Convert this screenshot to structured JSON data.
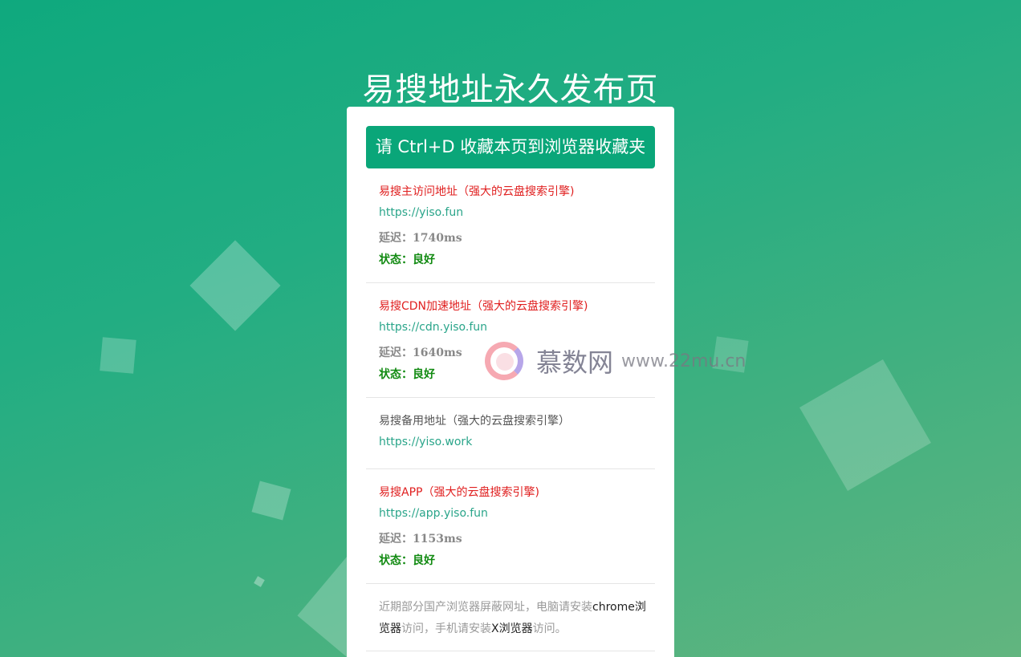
{
  "page": {
    "title": "易搜地址永久发布页"
  },
  "banner": {
    "text": "请 Ctrl+D 收藏本页到浏览器收藏夹"
  },
  "entries": [
    {
      "name": "易搜主访问地址（强大的云盘搜索引擎)",
      "url": "https://yiso.fun",
      "latency": "延迟：1740ms",
      "status": "状态：良好"
    },
    {
      "name": "易搜CDN加速地址（强大的云盘搜索引擎)",
      "url": "https://cdn.yiso.fun",
      "latency": "延迟：1640ms",
      "status": "状态：良好"
    },
    {
      "name": "易搜备用地址（强大的云盘搜索引擎）",
      "url": "https://yiso.work"
    },
    {
      "name": "易搜APP（强大的云盘搜索引擎)",
      "url": "https://app.yiso.fun",
      "latency": "延迟：1153ms",
      "status": "状态：良好"
    }
  ],
  "notice": {
    "part1": "近期部分国产浏览器屏蔽网址，电脑请安装",
    "link1": "chrome浏览器",
    "part2": "访问，手机请安装",
    "link2": "X浏览器",
    "part3": "访问。"
  },
  "watermark": {
    "name": "慕数网",
    "url": "www.22mu.cn"
  },
  "colors": {
    "accent": "#0aa679",
    "red": "#e02020",
    "status_green": "#118a11"
  }
}
